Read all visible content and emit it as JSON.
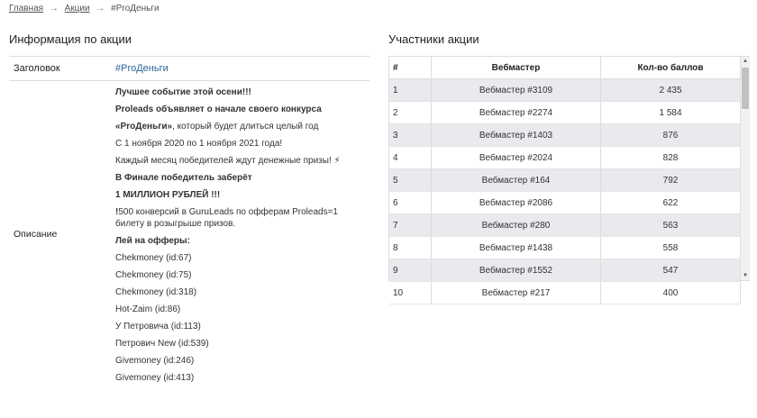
{
  "breadcrumb": {
    "home": "Главная",
    "promos": "Акции",
    "current": "#ProДеньги",
    "separator": "→"
  },
  "info": {
    "title": "Информация по акции",
    "heading_label": "Заголовок",
    "heading_value": "#ProДеньги",
    "description_label": "Описание",
    "lines": {
      "l1": "Лучшее событие этой осени!!!",
      "l2": "Proleads объявляет о начале своего конкурса",
      "l3_bold": "«ProДеньги»",
      "l3_rest": ", который будет длиться целый год",
      "l4": "С 1 ноября 2020 по 1 ноября 2021 года!",
      "l5": "Каждый месяц победителей ждут денежные призы! ⚡",
      "l6": "В Финале победитель заберёт",
      "l7": "1 МИЛЛИОН РУБЛЕЙ !!!",
      "l8_bold": "!",
      "l8_rest": "500 конверсий в GuruLeads по офферам Proleads=1 билету в розыгрыше призов.",
      "l9": "Лей на офферы:"
    },
    "offers": [
      "Chekmoney (id:67)",
      "Chekmoney (id:75)",
      "Chekmoney (id:318)",
      "Hot-Zaim (id:86)",
      "У Петровича (id:113)",
      "Петрович New (id:539)",
      "Givemoney (id:246)",
      "Givemoney (id:413)"
    ]
  },
  "participants": {
    "title": "Участники акции",
    "headers": {
      "num": "#",
      "webmaster": "Вебмастер",
      "points": "Кол-во баллов"
    },
    "rows": [
      {
        "num": "1",
        "webmaster": "Вебмастер #3109",
        "points": "2 435"
      },
      {
        "num": "2",
        "webmaster": "Вебмастер #2274",
        "points": "1 584"
      },
      {
        "num": "3",
        "webmaster": "Вебмастер #1403",
        "points": "876"
      },
      {
        "num": "4",
        "webmaster": "Вебмастер #2024",
        "points": "828"
      },
      {
        "num": "5",
        "webmaster": "Вебмастер #164",
        "points": "792"
      },
      {
        "num": "6",
        "webmaster": "Вебмастер #2086",
        "points": "622"
      },
      {
        "num": "7",
        "webmaster": "Вебмастер #280",
        "points": "563"
      },
      {
        "num": "8",
        "webmaster": "Вебмастер #1438",
        "points": "558"
      },
      {
        "num": "9",
        "webmaster": "Вебмастер #1552",
        "points": "547"
      },
      {
        "num": "10",
        "webmaster": "Вебмастер #217",
        "points": "400"
      }
    ]
  },
  "scrollbar": {
    "up": "▲",
    "down": "▼"
  }
}
